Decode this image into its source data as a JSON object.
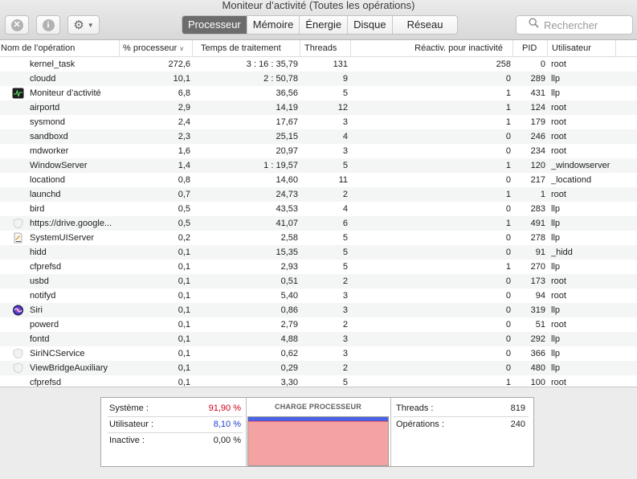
{
  "window": {
    "title": "Moniteur d’activité (Toutes les opérations)"
  },
  "toolbar": {
    "close_icon": "x-circle-icon",
    "info_icon": "info-circle-icon",
    "action_icon": "gear-icon",
    "tabs": [
      {
        "label": "Processeur",
        "active": true
      },
      {
        "label": "Mémoire",
        "active": false
      },
      {
        "label": "Énergie",
        "active": false
      },
      {
        "label": "Disque",
        "active": false
      },
      {
        "label": "Réseau",
        "active": false
      }
    ],
    "search": {
      "placeholder": "Rechercher",
      "value": ""
    }
  },
  "table": {
    "columns": {
      "name": "Nom de l’opération",
      "cpu": "% processeur",
      "time": "Temps de traitement",
      "threads": "Threads",
      "wakeups": "Réactiv. pour inactivité",
      "pid": "PID",
      "user": "Utilisateur"
    },
    "rows": [
      {
        "name": "kernel_task",
        "cpu": "272,6",
        "time": "3 : 16 : 35,79",
        "threads": "131",
        "wakeups": "258",
        "pid": "0",
        "user": "root",
        "icon": ""
      },
      {
        "name": "cloudd",
        "cpu": "10,1",
        "time": "2 : 50,78",
        "threads": "9",
        "wakeups": "0",
        "pid": "289",
        "user": "llp",
        "icon": ""
      },
      {
        "name": "Moniteur d’activité",
        "cpu": "6,8",
        "time": "36,56",
        "threads": "5",
        "wakeups": "1",
        "pid": "431",
        "user": "llp",
        "icon": "activity-monitor-icon"
      },
      {
        "name": "airportd",
        "cpu": "2,9",
        "time": "14,19",
        "threads": "12",
        "wakeups": "1",
        "pid": "124",
        "user": "root",
        "icon": ""
      },
      {
        "name": "sysmond",
        "cpu": "2,4",
        "time": "17,67",
        "threads": "3",
        "wakeups": "1",
        "pid": "179",
        "user": "root",
        "icon": ""
      },
      {
        "name": "sandboxd",
        "cpu": "2,3",
        "time": "25,15",
        "threads": "4",
        "wakeups": "0",
        "pid": "246",
        "user": "root",
        "icon": ""
      },
      {
        "name": "mdworker",
        "cpu": "1,6",
        "time": "20,97",
        "threads": "3",
        "wakeups": "0",
        "pid": "234",
        "user": "root",
        "icon": ""
      },
      {
        "name": "WindowServer",
        "cpu": "1,4",
        "time": "1 : 19,57",
        "threads": "5",
        "wakeups": "1",
        "pid": "120",
        "user": "_windowserver",
        "icon": ""
      },
      {
        "name": "locationd",
        "cpu": "0,8",
        "time": "14,60",
        "threads": "11",
        "wakeups": "0",
        "pid": "217",
        "user": "_locationd",
        "icon": ""
      },
      {
        "name": "launchd",
        "cpu": "0,7",
        "time": "24,73",
        "threads": "2",
        "wakeups": "1",
        "pid": "1",
        "user": "root",
        "icon": ""
      },
      {
        "name": "bird",
        "cpu": "0,5",
        "time": "43,53",
        "threads": "4",
        "wakeups": "0",
        "pid": "283",
        "user": "llp",
        "icon": ""
      },
      {
        "name": "https://drive.google...",
        "cpu": "0,5",
        "time": "41,07",
        "threads": "6",
        "wakeups": "1",
        "pid": "491",
        "user": "llp",
        "icon": "shield-icon"
      },
      {
        "name": "SystemUIServer",
        "cpu": "0,2",
        "time": "2,58",
        "threads": "5",
        "wakeups": "0",
        "pid": "278",
        "user": "llp",
        "icon": "document-icon"
      },
      {
        "name": "hidd",
        "cpu": "0,1",
        "time": "15,35",
        "threads": "5",
        "wakeups": "0",
        "pid": "91",
        "user": "_hidd",
        "icon": ""
      },
      {
        "name": "cfprefsd",
        "cpu": "0,1",
        "time": "2,93",
        "threads": "5",
        "wakeups": "1",
        "pid": "270",
        "user": "llp",
        "icon": ""
      },
      {
        "name": "usbd",
        "cpu": "0,1",
        "time": "0,51",
        "threads": "2",
        "wakeups": "0",
        "pid": "173",
        "user": "root",
        "icon": ""
      },
      {
        "name": "notifyd",
        "cpu": "0,1",
        "time": "5,40",
        "threads": "3",
        "wakeups": "0",
        "pid": "94",
        "user": "root",
        "icon": ""
      },
      {
        "name": "Siri",
        "cpu": "0,1",
        "time": "0,86",
        "threads": "3",
        "wakeups": "0",
        "pid": "319",
        "user": "llp",
        "icon": "siri-icon"
      },
      {
        "name": "powerd",
        "cpu": "0,1",
        "time": "2,79",
        "threads": "2",
        "wakeups": "0",
        "pid": "51",
        "user": "root",
        "icon": ""
      },
      {
        "name": "fontd",
        "cpu": "0,1",
        "time": "4,88",
        "threads": "3",
        "wakeups": "0",
        "pid": "292",
        "user": "llp",
        "icon": ""
      },
      {
        "name": "SiriNCService",
        "cpu": "0,1",
        "time": "0,62",
        "threads": "3",
        "wakeups": "0",
        "pid": "366",
        "user": "llp",
        "icon": "shield-icon"
      },
      {
        "name": "ViewBridgeAuxiliary",
        "cpu": "0,1",
        "time": "0,29",
        "threads": "2",
        "wakeups": "0",
        "pid": "480",
        "user": "llp",
        "icon": "shield-icon"
      },
      {
        "name": "cfprefsd",
        "cpu": "0,1",
        "time": "3,30",
        "threads": "5",
        "wakeups": "1",
        "pid": "100",
        "user": "root",
        "icon": ""
      }
    ]
  },
  "summary": {
    "system_label": "Système :",
    "system_value": "91,90 %",
    "user_label": "Utilisateur :",
    "user_value": "8,10 %",
    "idle_label": "Inactive :",
    "idle_value": "0,00 %",
    "chart_title": "CHARGE PROCESSEUR",
    "threads_label": "Threads :",
    "threads_value": "819",
    "processes_label": "Opérations :",
    "processes_value": "240",
    "colors": {
      "system": "#d0021b",
      "user": "#1f3fd0",
      "system_fill": "#f4a3a3",
      "user_fill": "#4a63e6"
    },
    "load": {
      "system_fraction": 0.919,
      "user_fraction": 0.081
    }
  }
}
